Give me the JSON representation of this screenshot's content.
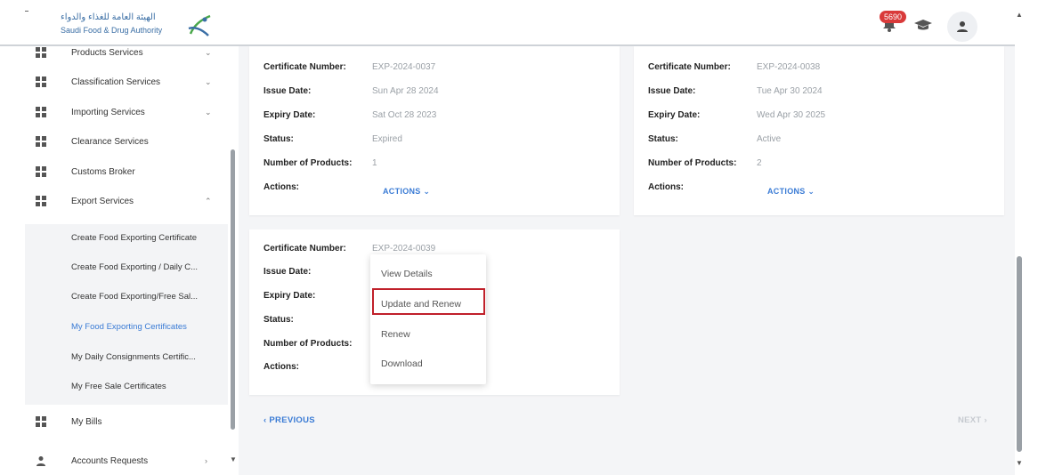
{
  "header": {
    "logo_ar": "الهيئة العامة للغذاء والدواء",
    "logo_en": "Saudi Food & Drug Authority",
    "notification_count": "5690",
    "icons": [
      "bell-icon",
      "graduation-cap-icon",
      "user-icon"
    ]
  },
  "sidebar": {
    "items": [
      {
        "label": "Products Services",
        "chevron": "⌄"
      },
      {
        "label": "Classification Services",
        "chevron": "⌄"
      },
      {
        "label": "Importing Services",
        "chevron": "⌄"
      },
      {
        "label": "Clearance Services",
        "chevron": ""
      },
      {
        "label": "Customs Broker",
        "chevron": ""
      },
      {
        "label": "Export Services",
        "chevron": "⌃"
      }
    ],
    "export_sub": [
      "Create Food Exporting Certificate",
      "Create Food Exporting / Daily C...",
      "Create Food Exporting/Free Sal...",
      "My Food Exporting Certificates",
      "My Daily Consignments Certific...",
      "My Free Sale Certificates"
    ],
    "bills": "My Bills",
    "accounts": "Accounts Requests",
    "accounts_chevron": "›"
  },
  "labels": {
    "certificate_number": "Certificate Number:",
    "issue_date": "Issue Date:",
    "expiry_date": "Expiry Date:",
    "status": "Status:",
    "number_of_products": "Number of Products:",
    "actions": "Actions:",
    "actions_button": "ACTIONS ⌄"
  },
  "certificates": [
    {
      "number": "EXP-2024-0037",
      "issue": "Sun Apr 28 2024",
      "expiry": "Sat Oct 28 2023",
      "status": "Expired",
      "products": "1"
    },
    {
      "number": "EXP-2024-0038",
      "issue": "Tue Apr 30 2024",
      "expiry": "Wed Apr 30 2025",
      "status": "Active",
      "products": "2"
    },
    {
      "number": "EXP-2024-0039"
    }
  ],
  "dropdown": {
    "items": [
      "View Details",
      "Update and Renew",
      "Renew",
      "Download"
    ],
    "highlighted": "Update and Renew",
    "highlight_color": "#c0202a"
  },
  "pager": {
    "prev": "‹  PREVIOUS",
    "next": "NEXT  ›"
  },
  "colors": {
    "accent": "#3a7bd5",
    "badge": "#d93a3a"
  }
}
